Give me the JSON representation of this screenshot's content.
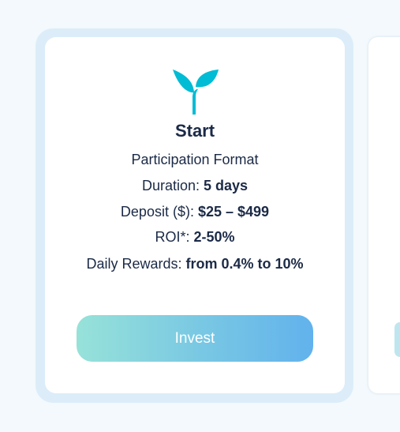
{
  "card": {
    "icon": "sprout-icon",
    "accent_color": "#00bcd4",
    "title": "Start",
    "format": "Participation Format",
    "duration_label": "Duration: ",
    "duration_value": "5 days",
    "deposit_label": "Deposit ($): ",
    "deposit_value": "$25 – $499",
    "roi_label": "ROI*: ",
    "roi_value": "2-50%",
    "daily_label": "Daily Rewards: ",
    "daily_value": "from 0.4% to 10%",
    "button_label": "Invest",
    "button_gradient": [
      "#97e2d9",
      "#62b2ed"
    ]
  }
}
